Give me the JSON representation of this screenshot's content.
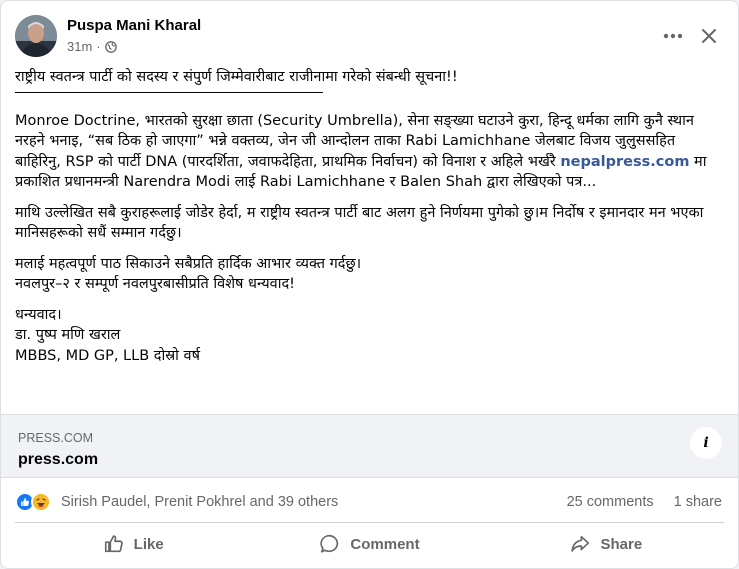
{
  "post": {
    "author": "Puspa Mani Kharal",
    "time": "31m",
    "dot": "·",
    "title": "राष्ट्रीय स्वतन्त्र पार्टी को सदस्य र संपुर्ण जिम्मेवारीबाट राजीनामा गरेको संबन्धी सूचना!!",
    "para1_before_link": "Monroe Doctrine, भारतको सुरक्षा छाता (Security Umbrella), सेना सङ्ख्या घटाउने कुरा, हिन्दू धर्मका लागि कुनै स्थान नरहने भनाइ, “सब ठिक हो जाएगा” भन्ने वक्तव्य, जेन जी आन्दोलन ताका Rabi Lamichhane जेलबाट विजय जुलुससहित बाहिरिनु, RSP को पार्टी DNA (पारदर्शिता, जवाफदेहिता, प्राथमिक निर्वाचन) को विनाश र अहिले भर्खरै",
    "para1_link": "nepalpress.com",
    "para1_after_link": "मा प्रकाशित प्रधानमन्त्री Narendra Modi लाई Rabi Lamichhane र Balen Shah द्वारा लेखिएको पत्र...",
    "para2": "माथि उल्लेखित सबै कुराहरूलाई जोडेर हेर्दा, म राष्ट्रीय स्वतन्त्र पार्टी बाट अलग हुने निर्णयमा पुगेको छु।म निर्दोष र इमानदार मन भएका मानिसहरूको सधैं सम्मान गर्दछु।",
    "para3_line1": "मलाई महत्वपूर्ण पाठ सिकाउने सबैप्रति हार्दिक आभार व्यक्त गर्दछु।",
    "para3_line2": "नवलपुर–२ र सम्पूर्ण नवलपुरबासीप्रति विशेष धन्यवाद!",
    "sign_line1": "धन्यवाद।",
    "sign_line2": "डा. पुष्प मणि खराल",
    "sign_line3": "MBBS, MD GP, LLB दोस्रो वर्ष"
  },
  "link_preview": {
    "domain": "PRESS.COM",
    "site": "press.com",
    "info_icon": "info-icon"
  },
  "stats": {
    "reactors": "Sirish Paudel, Prenit Pokhrel and 39 others",
    "comments": "25 comments",
    "shares": "1 share"
  },
  "actions": {
    "like": "Like",
    "comment": "Comment",
    "share": "Share"
  },
  "colors": {
    "link": "#385898",
    "like_blue": "#1877f2",
    "haha_yellow": "#f7b928",
    "muted": "#65676b"
  }
}
